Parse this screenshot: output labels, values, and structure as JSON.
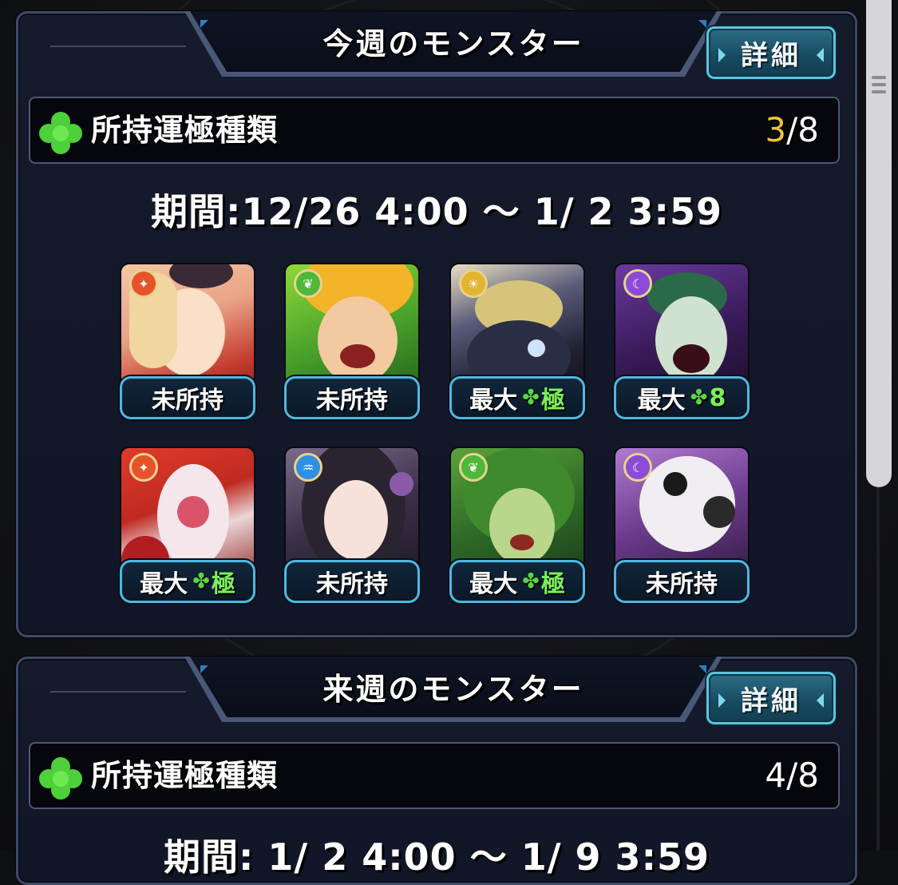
{
  "sections": [
    {
      "title": "今週のモンスター",
      "detail_label": "詳細",
      "count_label": "所持運極種類",
      "count_current": "3",
      "count_total": "/8",
      "count_current_color": "#f2c23a",
      "period": "期間:12/26  4:00 ～  1/ 2  3:59",
      "monsters": [
        {
          "attribute": "fire",
          "status": "未所持",
          "badge": ""
        },
        {
          "attribute": "wood",
          "status": "未所持",
          "badge": ""
        },
        {
          "attribute": "light",
          "status": "最大",
          "badge": "極"
        },
        {
          "attribute": "dark",
          "status": "最大",
          "badge": "8"
        },
        {
          "attribute": "fire",
          "status": "最大",
          "badge": "極"
        },
        {
          "attribute": "water",
          "status": "未所持",
          "badge": ""
        },
        {
          "attribute": "wood",
          "status": "最大",
          "badge": "極"
        },
        {
          "attribute": "dark",
          "status": "未所持",
          "badge": ""
        }
      ]
    },
    {
      "title": "来週のモンスター",
      "detail_label": "詳細",
      "count_label": "所持運極種類",
      "count_current": "4",
      "count_total": "/8",
      "period": "期間: 1/ 2  4:00 ～  1/ 9  3:59"
    }
  ],
  "icons": {
    "clover": "clover-icon",
    "attributes": {
      "fire": "#e5532b",
      "wood": "#4fb83a",
      "light": "#e3b431",
      "dark": "#8c4ad8",
      "water": "#2f8fe0"
    }
  }
}
